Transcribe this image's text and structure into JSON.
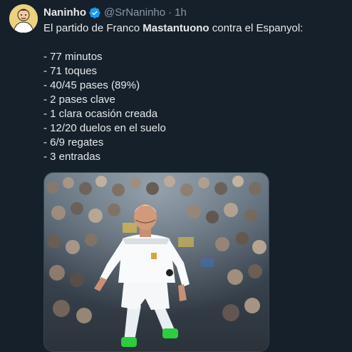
{
  "author": {
    "name": "Naninho",
    "handle": "@SrNaninho",
    "time": "1h",
    "verified_icon": "verified-badge-icon",
    "avatar_icon": "avatar-illustration"
  },
  "tweet": {
    "intro_prefix": "El partido de Franco ",
    "intro_bold": "Mastantuono",
    "intro_suffix": " contra el Espanyol:",
    "stats": [
      "- 77 minutos",
      "- 71 toques",
      "- 40/45 pases (89%)",
      "- 2 pases clave",
      "- 1 clara ocasión creada",
      "- 12/20 duelos en el suelo",
      "- 6/9 regates",
      "- 3 entradas"
    ]
  },
  "media": {
    "kind": "photo",
    "alt_icon": "football-player-photo"
  },
  "colors": {
    "background": "#15202b",
    "text": "#e7e9ea",
    "secondary": "#8b98a5",
    "verified": "#1d9bf0"
  }
}
